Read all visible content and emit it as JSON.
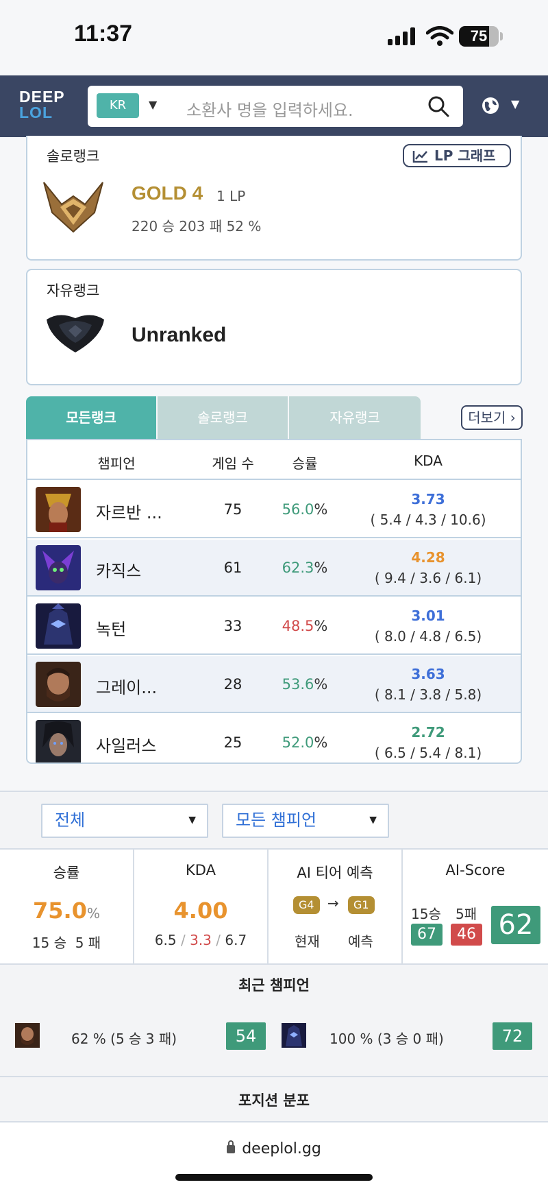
{
  "status_bar": {
    "time": "11:37",
    "battery": "75",
    "battery_level": 0.75
  },
  "header": {
    "logo_line1": "DEEP",
    "logo_line2": "LOL",
    "region": "KR",
    "search_placeholder": "소환사 명을 입력하세요."
  },
  "solo_rank": {
    "label": "솔로랭크",
    "lp_graph_button": "LP 그래프",
    "tier": "GOLD 4",
    "lp": "1 LP",
    "record": "220 승 203 패 52 %"
  },
  "flex_rank": {
    "label": "자유랭크",
    "tier": "Unranked"
  },
  "tabs": [
    {
      "label": "모든랭크",
      "active": true
    },
    {
      "label": "솔로랭크",
      "active": false
    },
    {
      "label": "자유랭크",
      "active": false
    }
  ],
  "more_button": "더보기",
  "champ_table": {
    "headers": {
      "champion": "챔피언",
      "games": "게임 수",
      "winrate": "승률",
      "kda": "KDA"
    },
    "rows": [
      {
        "name": "자르반 ...",
        "games": "75",
        "wr_num": "56.0",
        "wr_color": "#3f9a7a",
        "kda": "3.73",
        "kda_color": "#3e6fd8",
        "detail": "( 5.4 / 4.3 / 10.6)",
        "img": "jarvan-champion-icon"
      },
      {
        "name": "카직스",
        "games": "61",
        "wr_num": "62.3",
        "wr_color": "#3f9a7a",
        "kda": "4.28",
        "kda_color": "#e8932e",
        "detail": "( 9.4 / 3.6 / 6.1)",
        "img": "khazix-champion-icon"
      },
      {
        "name": "녹턴",
        "games": "33",
        "wr_num": "48.5",
        "wr_color": "#d14b4b",
        "kda": "3.01",
        "kda_color": "#3e6fd8",
        "detail": "( 8.0 / 4.8 / 6.5)",
        "img": "nocturne-champion-icon"
      },
      {
        "name": "그레이...",
        "games": "28",
        "wr_num": "53.6",
        "wr_color": "#3f9a7a",
        "kda": "3.63",
        "kda_color": "#3e6fd8",
        "detail": "( 8.1 / 3.8 / 5.8)",
        "img": "graves-champion-icon"
      },
      {
        "name": "사일러스",
        "games": "25",
        "wr_num": "52.0",
        "wr_color": "#3f9a7a",
        "kda": "2.72",
        "kda_color": "#3f9a7a",
        "detail": "( 6.5 / 5.4 / 8.1)",
        "img": "sylas-champion-icon"
      }
    ],
    "pct": "%"
  },
  "filters": {
    "queue": "전체",
    "champion": "모든 챔피언"
  },
  "stats": {
    "winrate_title": "승률",
    "winrate": "75.0",
    "winrate_unit": "%",
    "wins": "15 승",
    "losses": "5 패",
    "kda_title": "KDA",
    "kda": "4.00",
    "kills": "6.5",
    "deaths": "3.3",
    "assists": "6.7",
    "slash": "/",
    "ai_tier_title": "AI 티어 예측",
    "current_tier": "G4",
    "predicted_tier": "G1",
    "current_label": "현재",
    "predicted_label": "예측",
    "ai_score_title": "AI-Score",
    "win_label": "15승",
    "loss_label": "5패",
    "win_score": "67",
    "loss_score": "46",
    "total_score": "62"
  },
  "recent_champions": {
    "title": "최근 챔피언",
    "items": [
      {
        "text": "62 % (5 승  3 패)",
        "score": "54",
        "img": "graves-champion-icon"
      },
      {
        "text": "100 % (3 승  0 패)",
        "score": "72",
        "img": "nocturne-champion-icon"
      }
    ]
  },
  "position_title": "포지션 분포",
  "url": "deeplol.gg",
  "colors": {
    "header": "#3a4663",
    "accent": "#4fb3a9",
    "gold": "#b48f33",
    "win": "#3f9a7a",
    "loss": "#d14b4b",
    "kda_blue": "#3e6fd8",
    "orange": "#e8932e"
  }
}
